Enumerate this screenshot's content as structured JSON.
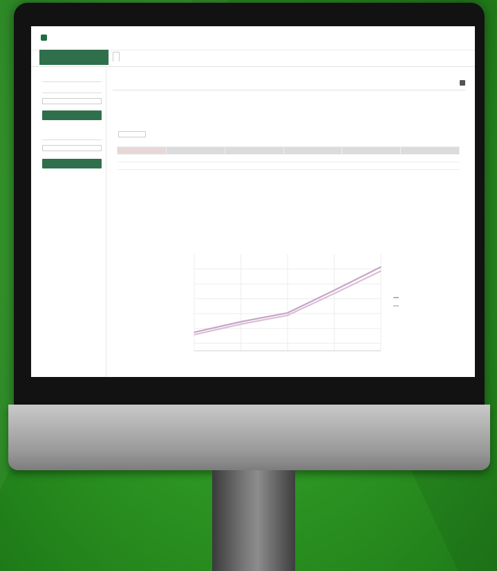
{
  "app": {
    "logo_text": "",
    "user_menu": ""
  },
  "nav": {
    "brand_label": "",
    "tabs": [
      {
        "label": ""
      },
      {
        "label": ""
      },
      {
        "label": ""
      },
      {
        "label": ""
      },
      {
        "label": ""
      }
    ]
  },
  "sidebar": {
    "group1_label": "",
    "group1_sublabel": "",
    "group1_select": "",
    "group1_button": "",
    "group2_label": "",
    "group2_select": "",
    "group2_button": ""
  },
  "main": {
    "title": "",
    "intro": "",
    "entries_label": "",
    "entries_value": "",
    "search_label": "",
    "right_control": "",
    "table": {
      "columns": [
        "",
        "",
        "",
        "",
        "",
        ""
      ],
      "rows": [
        [
          "",
          "",
          "",
          "",
          "",
          ""
        ],
        [
          "",
          "",
          "",
          "",
          "",
          ""
        ]
      ]
    },
    "note": ""
  },
  "colors": {
    "brand_green": "#2f6f4c",
    "background_green": "#2f9a24",
    "line_series": "#c9a9c9"
  },
  "chart_data": {
    "type": "line",
    "title": "",
    "xlabel": "",
    "ylabel": "",
    "categories": [
      "",
      "",
      "",
      "",
      ""
    ],
    "y_ticks": [
      "",
      "",
      "",
      "",
      "",
      ""
    ],
    "ylim": [
      0,
      6
    ],
    "series": [
      {
        "values": [
          1.15,
          1.8,
          2.35,
          3.75,
          5.2
        ]
      },
      {
        "values": [
          1.0,
          1.65,
          2.2,
          3.55,
          4.95
        ]
      }
    ],
    "grid": true,
    "legend": "right"
  }
}
